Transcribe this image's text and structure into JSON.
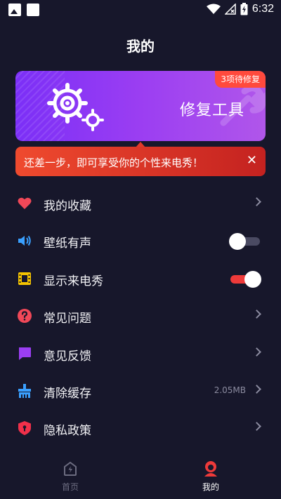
{
  "status_bar": {
    "time": "6:32"
  },
  "page": {
    "title": "我的"
  },
  "banner": {
    "title": "修复工具",
    "badge": "3项待修复"
  },
  "tip": {
    "text": "还差一步，即可享受你的个性来电秀！",
    "close": "✕"
  },
  "menu": [
    {
      "label": "我的收藏",
      "icon": "heart-icon",
      "control": "chevron"
    },
    {
      "label": "壁纸有声",
      "icon": "speaker-icon",
      "control": "toggle",
      "on": false
    },
    {
      "label": "显示来电秀",
      "icon": "film-icon",
      "control": "toggle",
      "on": true
    },
    {
      "label": "常见问题",
      "icon": "question-icon",
      "control": "chevron"
    },
    {
      "label": "意见反馈",
      "icon": "feedback-icon",
      "control": "chevron"
    },
    {
      "label": "清除缓存",
      "icon": "broom-icon",
      "control": "chevron",
      "value": "2.05MB"
    },
    {
      "label": "隐私政策",
      "icon": "shield-icon",
      "control": "chevron"
    }
  ],
  "bottom_nav": {
    "home": "首页",
    "mine": "我的",
    "active": "mine"
  },
  "colors": {
    "background": "#17172b",
    "accent_red": "#ee3a3a",
    "banner_purple": "#8a35f5",
    "heart": "#f04858",
    "speaker": "#3aa0ff",
    "film": "#f5c400",
    "question": "#f04858",
    "feedback": "#9b3ef2",
    "broom": "#3aa0ff",
    "shield": "#f0304a"
  }
}
